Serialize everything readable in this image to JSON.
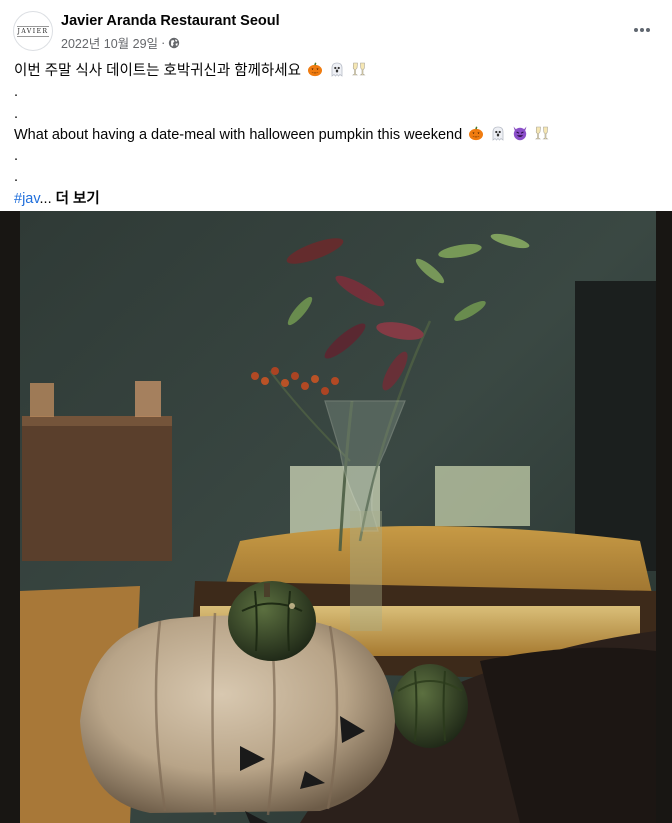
{
  "post": {
    "author": "Javier Aranda Restaurant Seoul",
    "avatar_text": "JAVIER",
    "date": "2022년 10월 29일",
    "separator": "·",
    "audience_icon": "globe-icon",
    "menu_icon": "more-horizontal-icon"
  },
  "caption": {
    "korean": "이번 주말 식사 데이트는 호박귀신과 함께하세요",
    "english": "What about having a date-meal with halloween pumpkin this weekend",
    "dot": ".",
    "hashtag": "#jav",
    "ellipsis": "...",
    "see_more": "더 보기",
    "korean_emojis": [
      "pumpkin",
      "ghost",
      "champagne-glasses"
    ],
    "english_emojis": [
      "pumpkin",
      "ghost",
      "smiling-devil",
      "champagne-glasses"
    ]
  },
  "photo": {
    "subject": "pumpkin-photo"
  },
  "colors": {
    "hashtag": "#216fdb",
    "meta_text": "#65676b",
    "text": "#050505"
  }
}
